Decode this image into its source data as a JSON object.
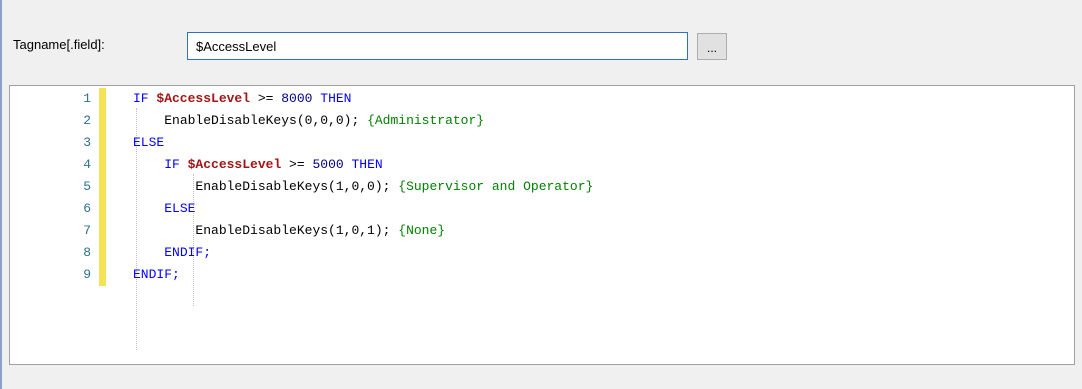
{
  "tag_field": {
    "label": "Tagname[.field]:",
    "value": "$AccessLevel",
    "browse_label": "..."
  },
  "code_lines": [
    {
      "num": "1",
      "indent": "",
      "tokens": [
        {
          "t": "IF ",
          "c": "kw"
        },
        {
          "t": "$AccessLevel",
          "c": "var"
        },
        {
          "t": " >= ",
          "c": "pl"
        },
        {
          "t": "8000",
          "c": "num"
        },
        {
          "t": " THEN",
          "c": "kw"
        }
      ]
    },
    {
      "num": "2",
      "indent": "    ",
      "tokens": [
        {
          "t": "EnableDisableKeys(0,0,0); ",
          "c": "pl"
        },
        {
          "t": "{Administrator}",
          "c": "cm"
        }
      ]
    },
    {
      "num": "3",
      "indent": "",
      "tokens": [
        {
          "t": "ELSE",
          "c": "kw"
        }
      ]
    },
    {
      "num": "4",
      "indent": "    ",
      "tokens": [
        {
          "t": "IF ",
          "c": "kw"
        },
        {
          "t": "$AccessLevel",
          "c": "var"
        },
        {
          "t": " >= ",
          "c": "pl"
        },
        {
          "t": "5000",
          "c": "num"
        },
        {
          "t": " THEN",
          "c": "kw"
        }
      ]
    },
    {
      "num": "5",
      "indent": "        ",
      "tokens": [
        {
          "t": "EnableDisableKeys(1,0,0); ",
          "c": "pl"
        },
        {
          "t": "{Supervisor and Operator}",
          "c": "cm"
        }
      ]
    },
    {
      "num": "6",
      "indent": "    ",
      "tokens": [
        {
          "t": "ELSE",
          "c": "kw"
        }
      ]
    },
    {
      "num": "7",
      "indent": "        ",
      "tokens": [
        {
          "t": "EnableDisableKeys(1,0,1); ",
          "c": "pl"
        },
        {
          "t": "{None}",
          "c": "cm"
        }
      ]
    },
    {
      "num": "8",
      "indent": "    ",
      "tokens": [
        {
          "t": "ENDIF;",
          "c": "kw"
        }
      ]
    },
    {
      "num": "9",
      "indent": "",
      "tokens": [
        {
          "t": "ENDIF;",
          "c": "kw"
        }
      ]
    }
  ],
  "colors": {
    "keyword": "#0000ff",
    "variable": "#a31515",
    "comment": "#008000",
    "margin_marker": "#f5e357",
    "input_border": "#2b73c4"
  }
}
